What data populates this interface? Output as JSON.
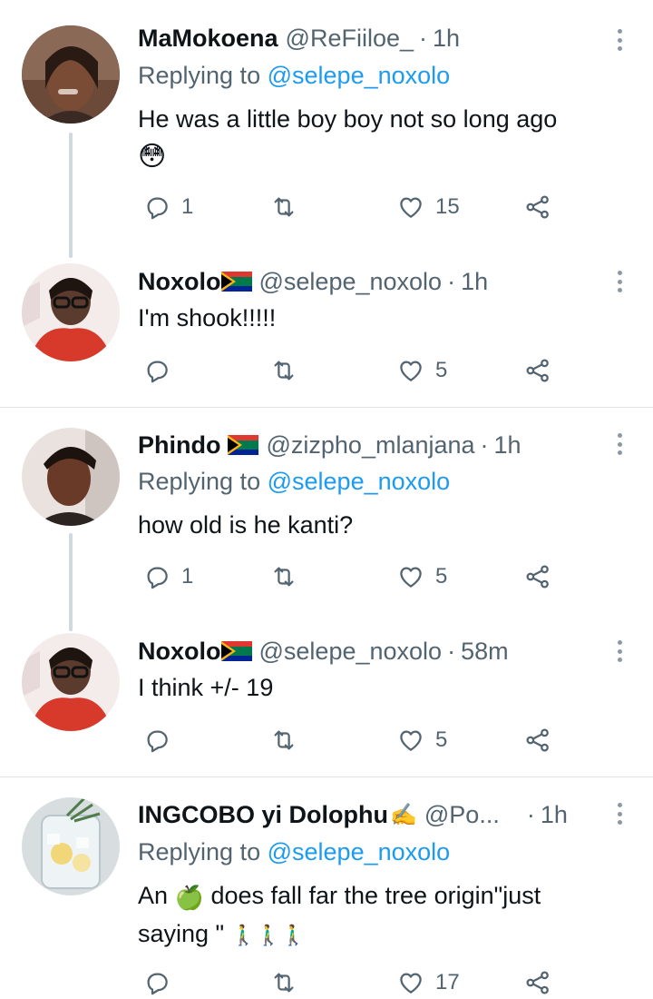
{
  "tweets": [
    {
      "name": "MaMokoena",
      "handle": "@ReFiiloe_",
      "separator": "·",
      "time": "1h",
      "replying_prefix": "Replying to",
      "replying_to": "@selepe_noxolo",
      "text": "He was a little boy boy not so long ago",
      "emoji": "😳",
      "reply_count": "1",
      "retweet_count": "",
      "like_count": "15"
    },
    {
      "name": "Noxolo",
      "handle": "@selepe_noxolo",
      "separator": "·",
      "time": "1h",
      "text": "I'm shook!!!!!",
      "reply_count": "",
      "retweet_count": "",
      "like_count": "5"
    },
    {
      "name": "Phindo",
      "handle": "@zizpho_mlanjana",
      "separator": "·",
      "time": "1h",
      "replying_prefix": "Replying to",
      "replying_to": "@selepe_noxolo",
      "text": "how old is he kanti?",
      "reply_count": "1",
      "retweet_count": "",
      "like_count": "5"
    },
    {
      "name": "Noxolo",
      "handle": "@selepe_noxolo",
      "separator": "·",
      "time": "58m",
      "text": "I think +/- 19",
      "reply_count": "",
      "retweet_count": "",
      "like_count": "5"
    },
    {
      "name": "INGCOBO yi Dolophu",
      "name_emoji": "✍️",
      "handle": "@Po...",
      "separator": "·",
      "time": "1h",
      "replying_prefix": "Replying to",
      "replying_to": "@selepe_noxolo",
      "text_line1_a": "An",
      "text_line1_emoji": "🍏",
      "text_line1_b": "does fall far the tree origin\"just",
      "text_line2": "saying \"",
      "text_line2_emoji": "🚶‍♂️🚶‍♂️🚶‍♂️",
      "reply_count": "",
      "retweet_count": "",
      "like_count": "17"
    }
  ],
  "icons": {
    "reply": "reply-icon",
    "retweet": "retweet-icon",
    "like": "heart-icon",
    "share": "share-icon",
    "more": "more-icon",
    "flag": "south-africa-flag-icon"
  },
  "colors": {
    "link": "#1d9bf0",
    "secondary": "#536471",
    "thread_line": "#cfd9de"
  }
}
